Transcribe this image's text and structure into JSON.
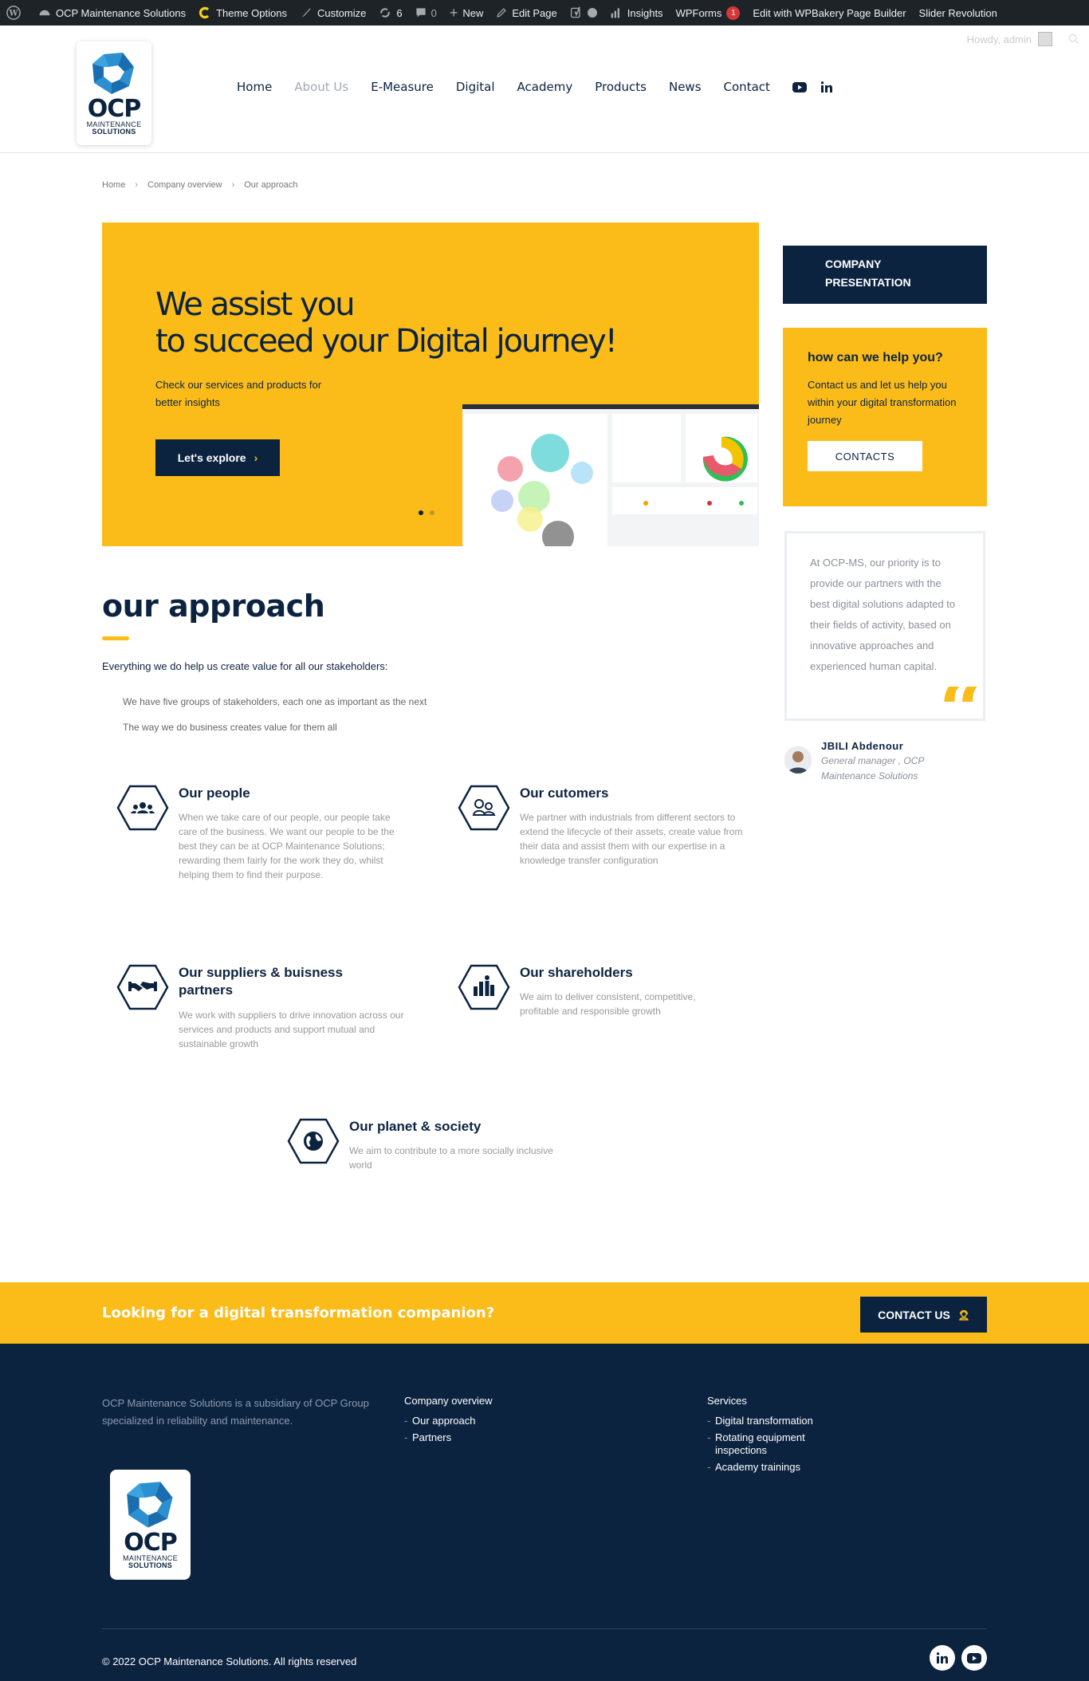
{
  "admin_bar": {
    "site_name": "OCP Maintenance Solutions",
    "theme_options": "Theme Options",
    "customize": "Customize",
    "updates_count": "6",
    "comments_count": "0",
    "new": "New",
    "edit_page": "Edit Page",
    "insights": "Insights",
    "wpforms": "WPForms",
    "wpforms_badge": "1",
    "wpbakery": "Edit with WPBakery Page Builder",
    "slider_revolution": "Slider Revolution",
    "howdy": "Howdy, admin"
  },
  "logo": {
    "name": "OCP",
    "line1": "MAINTENANCE",
    "line2": "SOLUTIONS"
  },
  "nav": {
    "items": [
      "Home",
      "About Us",
      "E-Measure",
      "Digital",
      "Academy",
      "Products",
      "News",
      "Contact"
    ],
    "active": "About Us"
  },
  "breadcrumb": [
    "Home",
    "Company overview",
    "Our approach"
  ],
  "hero": {
    "title_line1": "We assist you",
    "title_line2": "to succeed your Digital journey!",
    "subtitle": "Check our services and products for better insights",
    "button_label": "Let's explore"
  },
  "sidebar": {
    "company_btn_line1": "COMPANY",
    "company_btn_line2": "PRESENTATION",
    "help_title": "how can we help you?",
    "help_text": "Contact us and let us help you within your digital transformation journey",
    "contacts_btn": "CONTACTS",
    "quote": "At OCP-MS, our priority is to provide our partners with the best digital solutions adapted to their fields of activity, based on innovative approaches and experienced human capital.",
    "author_name": "JBILI Abdenour",
    "author_role_line1": "General manager , OCP",
    "author_role_line2": "Maintenance Solutions"
  },
  "approach": {
    "title": "our approach",
    "intro": "Everything we do help us create value for all our stakeholders:",
    "point1": "We have five groups of stakeholders, each one as important as the next",
    "point2": "The way we do business creates value for them all"
  },
  "stakeholders": {
    "people": {
      "title": "Our people",
      "text": "When we take care of our people, our people take care of the business. We want our people to be the best they can be at OCP Maintenance Solutions; rewarding them fairly for the work they do, whilst helping them to find their purpose."
    },
    "customers": {
      "title": "Our cutomers",
      "text": "We partner with industrials from different sectors to extend the lifecycle of their assets, create value from their data and assist them with our expertise in a knowledge transfer configuration"
    },
    "suppliers": {
      "title_line1": "Our suppliers & buisness",
      "title_line2": "partners",
      "text": "We work with suppliers to drive innovation across our services and products and support mutual and sustainable growth"
    },
    "shareholders": {
      "title": "Our shareholders",
      "text": "We aim to deliver consistent, competitive, profitable and responsible growth"
    },
    "planet": {
      "title": "Our planet & society",
      "text": "We aim to contribute to a more socially inclusive world"
    }
  },
  "cta": {
    "text": "Looking for a digital transformation companion?",
    "button": "CONTACT US"
  },
  "footer": {
    "about": "OCP Maintenance Solutions is a subsidiary of OCP Group specialized in reliability and maintenance.",
    "col1_title": "Company overview",
    "col1_items": [
      "Our approach",
      "Partners"
    ],
    "col2_title": "Services",
    "col2_items": [
      "Digital transformation",
      "Rotating equipment inspections",
      "Academy trainings"
    ],
    "copyright": "© 2022 OCP Maintenance Solutions. All rights reserved"
  },
  "colors": {
    "navy": "#0c2340",
    "yellow": "#fbbc1a",
    "admin_bar": "#1d2327"
  },
  "icons": [
    "wordpress-icon",
    "dashboard-icon",
    "theme-c-icon",
    "brush-icon",
    "updates-icon",
    "comment-icon",
    "plus-icon",
    "pencil-icon",
    "yoast-icon",
    "bar-chart-icon",
    "youtube-icon",
    "linkedin-icon",
    "users-icon",
    "handshake-icon",
    "shareholders-icon",
    "globe-icon",
    "support-agent-icon"
  ]
}
